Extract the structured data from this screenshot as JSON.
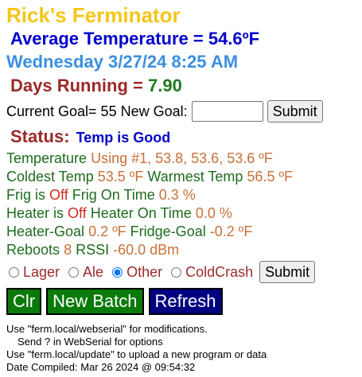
{
  "header": {
    "title": "Rick's Ferminator",
    "average": "Average Temperature = 54.6ºF",
    "datetime": "Wednesday 3/27/24 8:25 AM",
    "days_label": "Days Running = ",
    "days_value": "7.90"
  },
  "goal": {
    "current_label": "Current Goal= 55 New Goal:",
    "input_value": "",
    "submit_label": "Submit"
  },
  "status": {
    "label": "Status:",
    "value": "Temp is Good"
  },
  "readings": {
    "temperature_label": "Temperature",
    "temperature_value": "Using #1, 53.8, 53.6, 53.6 ºF",
    "coldest_label": "Coldest Temp",
    "coldest_value": "53.5 ºF",
    "warmest_label": "Warmest Temp",
    "warmest_value": "56.5 ºF",
    "frig_label": "Frig is",
    "frig_state": "Off",
    "frig_on_label": "Frig On Time",
    "frig_on_value": "0.3 %",
    "heater_label": "Heater is",
    "heater_state": "Off",
    "heater_on_label": "Heater On Time",
    "heater_on_value": "0.0 %",
    "heater_goal_label": "Heater-Goal",
    "heater_goal_value": "0.2 ºF",
    "fridge_goal_label": "Fridge-Goal",
    "fridge_goal_value": "-0.2 ºF",
    "reboots_label": "Reboots",
    "reboots_value": "8",
    "rssi_label": "RSSI",
    "rssi_value": "-60.0 dBm"
  },
  "mode": {
    "options": [
      "Lager",
      "Ale",
      "Other",
      "ColdCrash"
    ],
    "selected": "Other",
    "submit_label": "Submit"
  },
  "actions": {
    "clr_label": "Clr",
    "new_batch_label": "New Batch",
    "refresh_label": "Refresh"
  },
  "notes": {
    "line1": "Use \"ferm.local/webserial\" for modifications.",
    "line2": "Send ? in WebSerial for options",
    "line3": "Use \"ferm.local/update\" to upload a new program or data",
    "line4": "Date Compiled: Mar 26 2024 @ 09:54:32"
  },
  "colors": {
    "title": "#f5c518",
    "average": "#0000cc",
    "datetime": "#3a8fe0",
    "days": "#9b2a2a",
    "days_value": "#1e7a1e",
    "status_label": "#9b2a2a",
    "status_value": "#0000cc",
    "clr_bg": "#0a7a0a",
    "new_batch_bg": "#0a7a0a",
    "refresh_bg": "#000080"
  }
}
